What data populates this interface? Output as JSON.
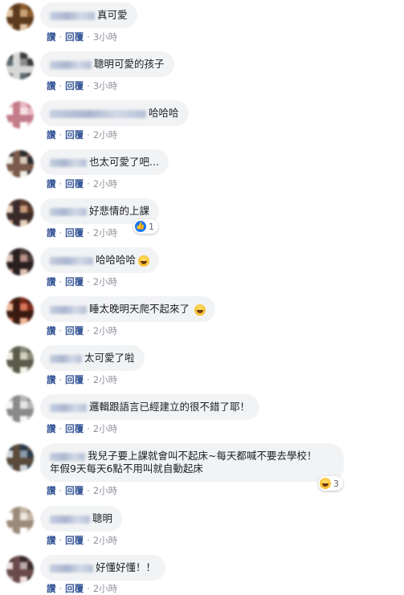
{
  "actions": {
    "like": "讚",
    "reply": "回覆"
  },
  "comments": [
    {
      "name_width": 56,
      "text": "真可愛",
      "time": "3小時",
      "palette": [
        "#8a5a2b",
        "#c9a27a",
        "#5b3a1d",
        "#e3c8a4"
      ]
    },
    {
      "name_width": 52,
      "text": "聰明可愛的孩子",
      "time": "3小時",
      "palette": [
        "#3b3b3b",
        "#8c8c8c",
        "#d7d7d7",
        "#5e6b73"
      ]
    },
    {
      "name_width": 120,
      "text": "哈哈哈",
      "time": "2小時",
      "palette": [
        "#e8b9c2",
        "#f6e2e6",
        "#c47c8a",
        "#ffffff"
      ]
    },
    {
      "name_width": 46,
      "text": "也太可愛了吧...",
      "time": "2小時",
      "palette": [
        "#2a2a2a",
        "#d8c8b8",
        "#7a5a4a",
        "#f2efe9"
      ]
    },
    {
      "name_width": 46,
      "text": "好悲情的上課",
      "time": "2小時",
      "palette": [
        "#5a3a2a",
        "#c49a7a",
        "#3a2a2a",
        "#e8d2be"
      ],
      "reaction": {
        "type": "like",
        "count": "1"
      }
    },
    {
      "name_width": 54,
      "text": "哈哈哈哈",
      "time": "2小時",
      "palette": [
        "#4a3a3a",
        "#b89088",
        "#2a1f1f",
        "#dcc3b8"
      ],
      "emoji": "grin"
    },
    {
      "name_width": 46,
      "text": "睡太晚明天爬不起來了",
      "time": "2小時",
      "palette": [
        "#7a2a1a",
        "#d8745a",
        "#3a1a10",
        "#f0b89a"
      ],
      "emoji": "smile"
    },
    {
      "name_width": 40,
      "text": "太可愛了啦",
      "time": "2小時",
      "palette": [
        "#8a8a7a",
        "#d2d2c0",
        "#5a5a4a",
        "#f0f0e6"
      ]
    },
    {
      "name_width": 46,
      "text": "邏輯跟語言已經建立的很不錯了耶！",
      "time": "2小時",
      "palette": [
        "#b8b8b8",
        "#e6e6e6",
        "#8a8a8a",
        "#f6f6f6"
      ]
    },
    {
      "name_width": 44,
      "text": "我兒子要上課就會叫不起床~每天都喊不要去學校！",
      "text2": "年假9天每天6點不用叫就自動起床",
      "time": "2小時",
      "palette": [
        "#2a3a4a",
        "#8a9aa8",
        "#5a4a3a",
        "#d0d6dc"
      ],
      "reaction": {
        "type": "haha",
        "count": "3"
      }
    },
    {
      "name_width": 50,
      "text": "聰明",
      "time": "2小時",
      "palette": [
        "#c8b8a8",
        "#efe6dc",
        "#9a8a7a",
        "#ffffff"
      ]
    },
    {
      "name_width": 54,
      "text": "好懂好懂！！",
      "time": "2小時",
      "palette": [
        "#3a2a2a",
        "#b8a8a8",
        "#6a4a4a",
        "#ecdede"
      ]
    }
  ]
}
